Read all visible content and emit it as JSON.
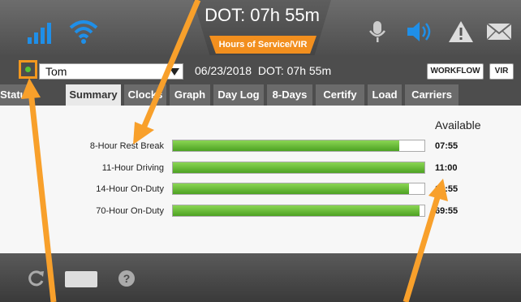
{
  "header": {
    "dot_clock": "DOT: 07h 55m",
    "hos_tab_label": "Hours of Service/VIR",
    "icons": [
      "signal-icon",
      "wifi-icon",
      "microphone-icon",
      "speaker-icon",
      "warning-icon",
      "mail-icon"
    ]
  },
  "driver_bar": {
    "status": "online",
    "status_color": "#57c236",
    "driver_name": "Tom",
    "date": "06/23/2018",
    "dot_clock": "DOT: 07h 55m",
    "workflow_label": "WORKFLOW",
    "vir_label": "VIR"
  },
  "tabs": [
    {
      "label": "Status",
      "active": false
    },
    {
      "label": "Summary",
      "active": true
    },
    {
      "label": "Clocks",
      "active": false
    },
    {
      "label": "Graph",
      "active": false
    },
    {
      "label": "Day Log",
      "active": false
    },
    {
      "label": "8-Days",
      "active": false
    },
    {
      "label": "Certify",
      "active": false
    },
    {
      "label": "Load",
      "active": false
    },
    {
      "label": "Carriers",
      "active": false
    }
  ],
  "summary": {
    "column_header": "Available",
    "rows": [
      {
        "label": "8-Hour Rest Break",
        "fill_fraction": 0.9,
        "available": "07:55"
      },
      {
        "label": "11-Hour Driving",
        "fill_fraction": 1.0,
        "available": "11:00"
      },
      {
        "label": "14-Hour On-Duty",
        "fill_fraction": 0.94,
        "available": "13:55"
      },
      {
        "label": "70-Hour On-Duty",
        "fill_fraction": 0.98,
        "available": "69:55"
      }
    ]
  },
  "bottom_bar": {
    "icons": [
      "refresh-icon",
      "keyboard-icon",
      "help-icon"
    ],
    "help_glyph": "?"
  },
  "colors": {
    "accent": "#f28f1e",
    "arrow": "#f8a02b",
    "bar_green": "#6cc13a"
  }
}
